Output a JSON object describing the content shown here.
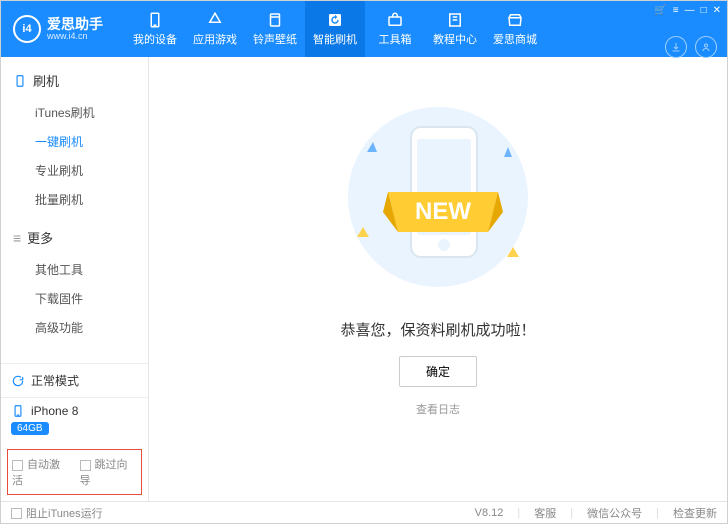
{
  "app": {
    "name": "爱思助手",
    "url": "www.i4.cn",
    "logo_text": "i4"
  },
  "nav": {
    "items": [
      {
        "label": "我的设备"
      },
      {
        "label": "应用游戏"
      },
      {
        "label": "铃声壁纸"
      },
      {
        "label": "智能刷机"
      },
      {
        "label": "工具箱"
      },
      {
        "label": "教程中心"
      },
      {
        "label": "爱思商城"
      }
    ],
    "active_index": 3
  },
  "sidebar": {
    "sections": [
      {
        "title": "刷机",
        "items": [
          {
            "label": "iTunes刷机"
          },
          {
            "label": "一键刷机"
          },
          {
            "label": "专业刷机"
          },
          {
            "label": "批量刷机"
          }
        ],
        "active_index": 1
      },
      {
        "title": "更多",
        "items": [
          {
            "label": "其他工具"
          },
          {
            "label": "下载固件"
          },
          {
            "label": "高级功能"
          }
        ],
        "active_index": -1
      }
    ],
    "status": {
      "label": "正常模式"
    },
    "device": {
      "name": "iPhone 8",
      "storage": "64GB"
    },
    "options": [
      {
        "label": "自动激活"
      },
      {
        "label": "跳过向导"
      }
    ]
  },
  "main": {
    "illus_banner": "NEW",
    "message": "恭喜您，保资料刷机成功啦！",
    "ok_label": "确定",
    "log_link": "查看日志"
  },
  "footer": {
    "block_itunes": "阻止iTunes运行",
    "version": "V8.12",
    "links": [
      "客服",
      "微信公众号",
      "检查更新"
    ]
  }
}
